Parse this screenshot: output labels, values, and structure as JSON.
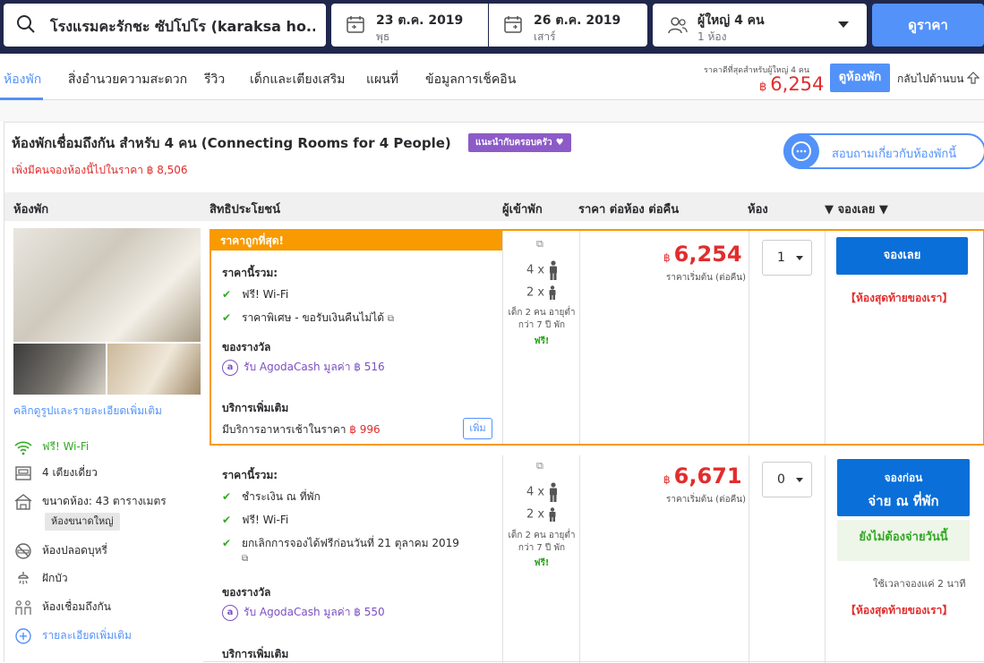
{
  "topbar": {
    "search_value": "โรงแรมคะรักชะ ซัปโปโร (karaksa ho...",
    "checkin_date": "23 ต.ค. 2019",
    "checkin_day": "พุธ",
    "checkout_date": "26 ต.ค. 2019",
    "checkout_day": "เสาร์",
    "guests_main": "ผู้ใหญ่ 4 คน",
    "guests_sub": "1 ห้อง",
    "search_button": "ดูราคา"
  },
  "tabs": [
    {
      "label": "ห้องพัก"
    },
    {
      "label": "สิ่งอำนวยความสะดวก"
    },
    {
      "label": "รีวิว"
    },
    {
      "label": "เด็กและเตียงเสริม"
    },
    {
      "label": "แผนที่"
    },
    {
      "label": "ข้อมูลการเช็คอิน"
    }
  ],
  "price_header": {
    "note": "ราคาดีที่สุดสำหรับผู้ใหญ่ 4 คน",
    "currency": "฿",
    "price": "6,254",
    "see_rooms_button": "ดูห้องพัก",
    "back_to_top": "กลับไปด้านบน"
  },
  "room": {
    "title": "ห้องพักเชื่อมถึงกัน สำหรับ 4 คน (Connecting Rooms for 4 People)",
    "badge": "แนะนำกับครอบครัว",
    "booked_note": "เพิ่งมีคนจองห้องนี้ไปในราคา ฿ 8,506",
    "ask_button": "สอบถามเกี่ยวกับห้องพักนี้",
    "more_photos": "คลิกดูรูปและรายละเอียดเพิ่มเติม",
    "features": {
      "wifi": "ฟรี! Wi-Fi",
      "beds": "4 เตียงเดี่ยว",
      "size": "ขนาดห้อง: 43 ตารางเมตร",
      "size_tag": "ห้องขนาดใหญ่",
      "nonsmoking": "ห้องปลอดบุหรี่",
      "shower": "ฝักบัว",
      "connecting": "ห้องเชื่อมถึงกัน",
      "more_details": "รายละเอียดเพิ่มเติม"
    }
  },
  "table_headers": {
    "room": "ห้องพัก",
    "benefits": "สิทธิประโยชน์",
    "guests": "ผู้เข้าพัก",
    "price": "ราคา ต่อห้อง ต่อคืน",
    "rooms": "ห้อง",
    "book": "▼ จองเลย ▼"
  },
  "offers": [
    {
      "banner": "ราคาถูกที่สุด!",
      "includes_label": "ราคานี้รวม:",
      "benefits": [
        "ฟรี! Wi-Fi",
        "ราคาพิเศษ - ขอรับเงินคืนไม่ได้"
      ],
      "rewards_label": "ของรางวัล",
      "agoda_cash": "รับ AgodaCash มูลค่า ฿ 516",
      "extras_label": "บริการเพิ่มเติม",
      "breakfast_text": "มีบริการอาหารเช้าในราคา ",
      "breakfast_price": "฿ 996",
      "add_button": "เพิ่ม",
      "adults": "4 x",
      "children": "2 x",
      "child_note": "เด็ก 2 คน อายุต่ำกว่า 7 ปี พัก",
      "free": "ฟรี!",
      "currency": "฿",
      "price": "6,254",
      "price_sub": "ราคาเริ่มต้น (ต่อคืน)",
      "qty": "1",
      "book_button": "จองเลย",
      "last_room": "【ห้องสุดท้ายของเรา】"
    },
    {
      "includes_label": "ราคานี้รวม:",
      "benefits": [
        "ชำระเงิน ณ ที่พัก",
        "ฟรี! Wi-Fi",
        "ยกเลิกการจองได้ฟรีก่อนวันที่ 21 ตุลาคม 2019"
      ],
      "rewards_label": "ของรางวัล",
      "agoda_cash": "รับ AgodaCash มูลค่า ฿ 550",
      "extras_label": "บริการเพิ่มเติม",
      "adults": "4 x",
      "children": "2 x",
      "child_note": "เด็ก 2 คน อายุต่ำกว่า 7 ปี พัก",
      "free": "ฟรี!",
      "currency": "฿",
      "price": "6,671",
      "price_sub": "ราคาเริ่มต้น (ต่อคืน)",
      "qty": "0",
      "book_line1": "จองก่อน",
      "book_line2": "จ่าย ณ ที่พัก",
      "no_pay": "ยังไม่ต้องจ่ายวันนี้",
      "time_note": "ใช้เวลาจองแค่ 2 นาที",
      "last_room": "【ห้องสุดท้ายของเรา】"
    }
  ],
  "colors": {
    "accent": "#5392f9",
    "topbar": "#20274d",
    "price_red": "#e12d2d",
    "cheapest_orange": "#f89a00",
    "book_blue": "#0a6fd8",
    "green": "#32a923",
    "purple": "#7b4fc4"
  }
}
